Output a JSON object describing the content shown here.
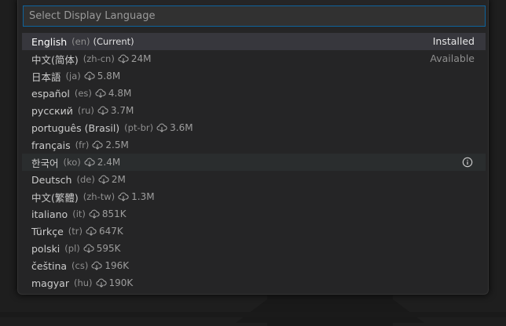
{
  "picker": {
    "placeholder": "Select Display Language",
    "items": [
      {
        "name": "English",
        "code": "(en)",
        "current": "(Current)",
        "status": "Installed"
      },
      {
        "name": "中文(简体)",
        "code": "(zh-cn)",
        "size": "24M",
        "status": "Available"
      },
      {
        "name": "日本語",
        "code": "(ja)",
        "size": "5.8M"
      },
      {
        "name": "español",
        "code": "(es)",
        "size": "4.8M"
      },
      {
        "name": "русский",
        "code": "(ru)",
        "size": "3.7M"
      },
      {
        "name": "português (Brasil)",
        "code": "(pt-br)",
        "size": "3.6M"
      },
      {
        "name": "français",
        "code": "(fr)",
        "size": "2.5M"
      },
      {
        "name": "한국어",
        "code": "(ko)",
        "size": "2.4M"
      },
      {
        "name": "Deutsch",
        "code": "(de)",
        "size": "2M"
      },
      {
        "name": "中文(繁體)",
        "code": "(zh-tw)",
        "size": "1.3M"
      },
      {
        "name": "italiano",
        "code": "(it)",
        "size": "851K"
      },
      {
        "name": "Türkçe",
        "code": "(tr)",
        "size": "647K"
      },
      {
        "name": "polski",
        "code": "(pl)",
        "size": "595K"
      },
      {
        "name": "čeština",
        "code": "(cs)",
        "size": "196K"
      },
      {
        "name": "magyar",
        "code": "(hu)",
        "size": "190K"
      }
    ]
  },
  "colors": {
    "accent_border": "#0e639c",
    "widget_bg": "#252526",
    "selected_row": "#37373d",
    "hover_row": "#2a2d2e"
  },
  "icons": {
    "download": "cloud-download-icon",
    "info": "info-icon"
  }
}
